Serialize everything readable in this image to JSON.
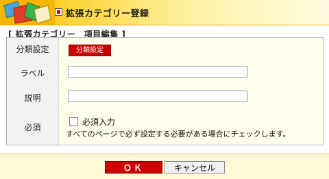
{
  "header": {
    "title": "拡張カテゴリー登録"
  },
  "section": {
    "title": "[ 拡張カテゴリー　項目編集 ]"
  },
  "form": {
    "category": {
      "label": "分類設定",
      "value": "分類設定"
    },
    "label_field": {
      "label": "ラベル",
      "value": ""
    },
    "description_field": {
      "label": "説明",
      "value": ""
    },
    "required_field": {
      "label": "必須",
      "checkbox_label": "必須入力",
      "checked": false,
      "help_text": "すべてのページで必ず設定する必要がある場合にチェックします。"
    }
  },
  "footer": {
    "ok_label": "ＯＫ",
    "cancel_label": "キャンセル"
  },
  "colors": {
    "accent_red": "#cc0000",
    "header_gold": "#f7b400",
    "panel_bg": "#fffbea"
  }
}
